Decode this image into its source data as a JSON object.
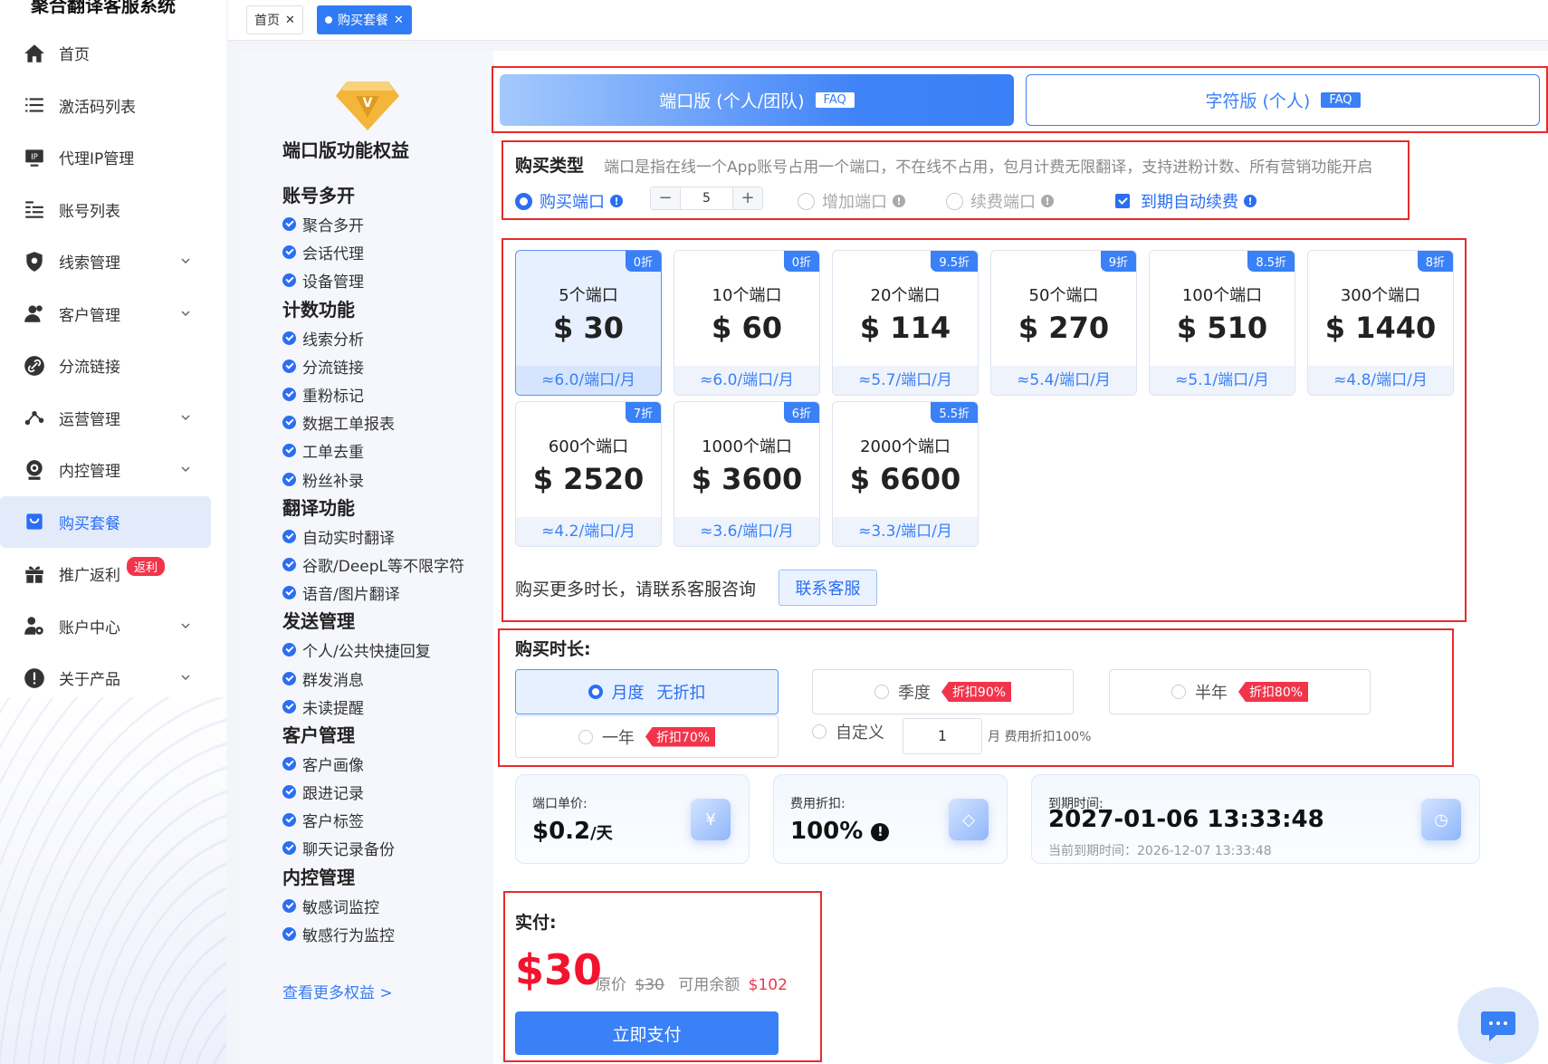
{
  "app": {
    "title": "聚合翻译客服系统"
  },
  "sidebar": {
    "items": [
      {
        "label": "首页",
        "icon": "home-icon",
        "chevron": false
      },
      {
        "label": "激活码列表",
        "icon": "list-icon",
        "chevron": false
      },
      {
        "label": "代理IP管理",
        "icon": "ip-icon",
        "chevron": false
      },
      {
        "label": "账号列表",
        "icon": "account-list-icon",
        "chevron": false
      },
      {
        "label": "线索管理",
        "icon": "shield-icon",
        "chevron": true
      },
      {
        "label": "客户管理",
        "icon": "users-icon",
        "chevron": true
      },
      {
        "label": "分流链接",
        "icon": "link-icon",
        "chevron": false
      },
      {
        "label": "运营管理",
        "icon": "share-icon",
        "chevron": true
      },
      {
        "label": "内控管理",
        "icon": "camera-icon",
        "chevron": true
      },
      {
        "label": "购买套餐",
        "icon": "bag-icon",
        "chevron": false,
        "active": true
      },
      {
        "label": "推广返利",
        "icon": "gift-icon",
        "chevron": false,
        "badge": "返利"
      },
      {
        "label": "账户中心",
        "icon": "user-gear-icon",
        "chevron": true
      },
      {
        "label": "关于产品",
        "icon": "info-icon",
        "chevron": true
      }
    ]
  },
  "tabs": [
    {
      "label": "首页",
      "active": false
    },
    {
      "label": "购买套餐",
      "active": true
    }
  ],
  "benefits": {
    "title": "端口版功能权益",
    "groups": [
      {
        "name": "账号多开",
        "items": [
          "聚合多开",
          "会话代理",
          "设备管理"
        ]
      },
      {
        "name": "计数功能",
        "items": [
          "线索分析",
          "分流链接",
          "重粉标记",
          "数据工单报表",
          "工单去重",
          "粉丝补录"
        ]
      },
      {
        "name": "翻译功能",
        "items": [
          "自动实时翻译",
          "谷歌/DeepL等不限字符",
          "语音/图片翻译"
        ]
      },
      {
        "name": "发送管理",
        "items": [
          "个人/公共快捷回复",
          "群发消息",
          "未读提醒"
        ]
      },
      {
        "name": "客户管理",
        "items": [
          "客户画像",
          "跟进记录",
          "客户标签",
          "聊天记录备份"
        ]
      },
      {
        "name": "内控管理",
        "items": [
          "敏感词监控",
          "敏感行为监控"
        ]
      }
    ],
    "more_link": "查看更多权益 >"
  },
  "version": {
    "port": {
      "label": "端口版 (个人/团队)",
      "faq": "FAQ"
    },
    "char": {
      "label": "字符版 (个人)",
      "faq": "FAQ"
    }
  },
  "purchase_type": {
    "label": "购买类型",
    "desc": "端口是指在线一个App账号占用一个端口，不在线不占用，包月计费无限翻译，支持进粉计数、所有营销功能开启",
    "buy": "购买端口",
    "qty": "5",
    "add": "增加端口",
    "renew": "续费端口",
    "auto_renew": "到期自动续费"
  },
  "packages": [
    {
      "name": "5个端口",
      "price": "$ 30",
      "discount": "0折",
      "unit": "≈6.0/端口/月",
      "selected": true
    },
    {
      "name": "10个端口",
      "price": "$ 60",
      "discount": "0折",
      "unit": "≈6.0/端口/月"
    },
    {
      "name": "20个端口",
      "price": "$ 114",
      "discount": "9.5折",
      "unit": "≈5.7/端口/月"
    },
    {
      "name": "50个端口",
      "price": "$ 270",
      "discount": "9折",
      "unit": "≈5.4/端口/月"
    },
    {
      "name": "100个端口",
      "price": "$ 510",
      "discount": "8.5折",
      "unit": "≈5.1/端口/月"
    },
    {
      "name": "300个端口",
      "price": "$ 1440",
      "discount": "8折",
      "unit": "≈4.8/端口/月"
    },
    {
      "name": "600个端口",
      "price": "$ 2520",
      "discount": "7折",
      "unit": "≈4.2/端口/月"
    },
    {
      "name": "1000个端口",
      "price": "$ 3600",
      "discount": "6折",
      "unit": "≈3.6/端口/月"
    },
    {
      "name": "2000个端口",
      "price": "$ 6600",
      "discount": "5.5折",
      "unit": "≈3.3/端口/月"
    }
  ],
  "contact": {
    "text": "购买更多时长，请联系客服咨询",
    "button": "联系客服"
  },
  "duration": {
    "label": "购买时长:",
    "monthly": {
      "label": "月度",
      "extra": "无折扣"
    },
    "quarter": {
      "label": "季度",
      "tag": "折扣90%"
    },
    "half": {
      "label": "半年",
      "tag": "折扣80%"
    },
    "year": {
      "label": "一年",
      "tag": "折扣70%"
    },
    "custom": {
      "label": "自定义",
      "value": "1",
      "unit": "月 费用折扣100%"
    }
  },
  "info": {
    "unit_price": {
      "key": "端口单价:",
      "value": "$0.2",
      "suffix": "/天"
    },
    "discount": {
      "key": "费用折扣:",
      "value": "100%"
    },
    "expire": {
      "key": "到期时间:",
      "value": "2027-01-06 13:33:48",
      "sub": "当前到期时间：2026-12-07 13:33:48"
    }
  },
  "payment": {
    "label": "实付:",
    "amount": "$30",
    "orig_label": "原价",
    "orig": "$30",
    "balance_label": "可用余额",
    "balance": "$102",
    "button": "立即支付"
  }
}
